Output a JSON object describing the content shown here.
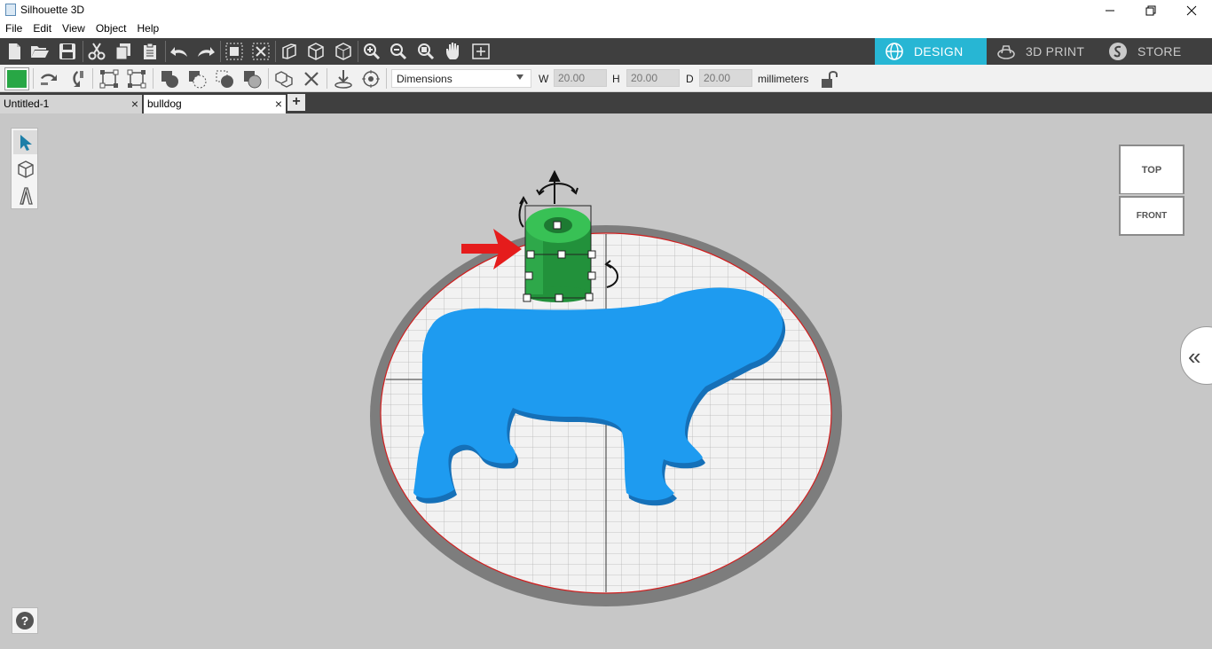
{
  "window": {
    "title": "Silhouette 3D",
    "minimize_icon": "minimize-icon",
    "restore_icon": "restore-icon",
    "close_icon": "close-icon"
  },
  "menu": [
    "File",
    "Edit",
    "View",
    "Object",
    "Help"
  ],
  "mode_tabs": [
    {
      "label": "DESIGN",
      "icon": "globe-icon",
      "active": true
    },
    {
      "label": "3D PRINT",
      "icon": "printer-icon",
      "active": false
    },
    {
      "label": "STORE",
      "icon": "store-icon",
      "active": false
    }
  ],
  "properties": {
    "fill_color": "#28a745",
    "dimension_mode": "Dimensions",
    "w_label": "W",
    "w_value": "20.00",
    "h_label": "H",
    "h_value": "20.00",
    "d_label": "D",
    "d_value": "20.00",
    "units": "millimeters"
  },
  "doc_tabs": [
    {
      "label": "Untitled-1",
      "active": false
    },
    {
      "label": "bulldog",
      "active": true
    }
  ],
  "view_cube": {
    "top": "TOP",
    "front": "FRONT"
  },
  "colors": {
    "accent": "#27b6d4",
    "toolbar_dark": "#3f3f3f",
    "model_blue": "#1e9bf0",
    "model_green": "#2ea84a",
    "arrow_red": "#e51c1c"
  }
}
